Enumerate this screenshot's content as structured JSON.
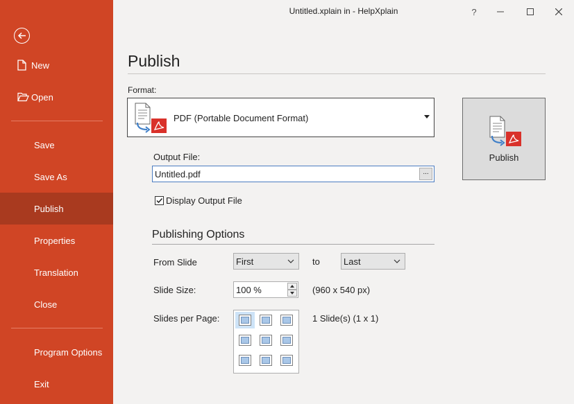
{
  "window": {
    "title": "Untitled.xplain in  - HelpXplain",
    "help": "?",
    "controls": [
      "minimize-icon",
      "maximize-icon",
      "close-icon"
    ]
  },
  "sidebar": {
    "back_icon": "back-arrow-icon",
    "items": [
      {
        "label": "New",
        "icon": "new-document-icon"
      },
      {
        "label": "Open",
        "icon": "folder-open-icon"
      },
      {
        "label": "Save"
      },
      {
        "label": "Save As"
      },
      {
        "label": "Publish",
        "active": true
      },
      {
        "label": "Properties"
      },
      {
        "label": "Translation"
      },
      {
        "label": "Close"
      },
      {
        "label": "Program Options"
      },
      {
        "label": "Exit"
      }
    ],
    "color": "#d04525",
    "active_color": "#a93a1f"
  },
  "main": {
    "heading": "Publish",
    "format_label": "Format:",
    "format_value": "PDF (Portable Document Format)",
    "publish_button": "Publish",
    "output_label": "Output File:",
    "output_value": "Untitled.pdf",
    "browse_label": "...",
    "display_output_label": "Display Output File",
    "display_output_checked": true,
    "options_heading": "Publishing Options",
    "from_slide_label": "From Slide",
    "from_slide_value": "First",
    "to_label": "to",
    "to_value": "Last",
    "slide_size_label": "Slide Size:",
    "slide_size_value": "100 %",
    "slide_size_dims": "(960 x 540 px)",
    "slides_per_page_label": "Slides per Page:",
    "slides_per_page_value": "1 Slide(s) (1 x 1)"
  }
}
